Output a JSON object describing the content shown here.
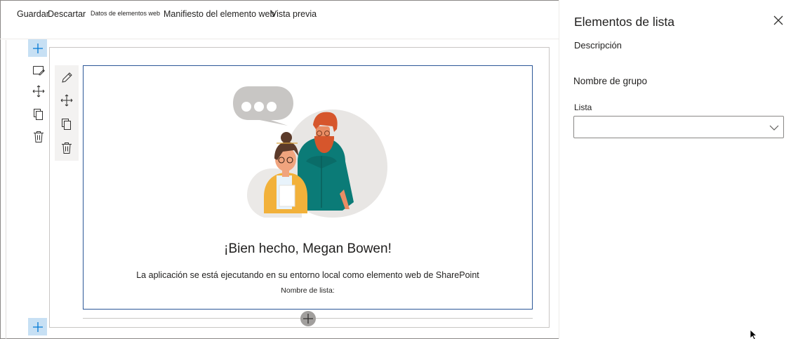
{
  "toolbar": {
    "items": [
      {
        "label": "Guardar"
      },
      {
        "label": "Descartar"
      },
      {
        "label": "Datos de elementos web"
      },
      {
        "label": "Manifiesto del elemento web"
      },
      {
        "label": "Vista previa"
      }
    ]
  },
  "webpart": {
    "heading": "¡Bien hecho, Megan Bowen!",
    "description": "La aplicación se está ejecutando en su entorno local como elemento web de SharePoint",
    "list_name_label": "Nombre de lista:"
  },
  "pane": {
    "title": "Elementos de lista",
    "description": "Descripción",
    "group_name": "Nombre de grupo",
    "list_label": "Lista",
    "list_value": ""
  },
  "colors": {
    "accent": "#0078d4",
    "accent_light": "#c7e0f4",
    "webpart_border": "#2b5797"
  }
}
